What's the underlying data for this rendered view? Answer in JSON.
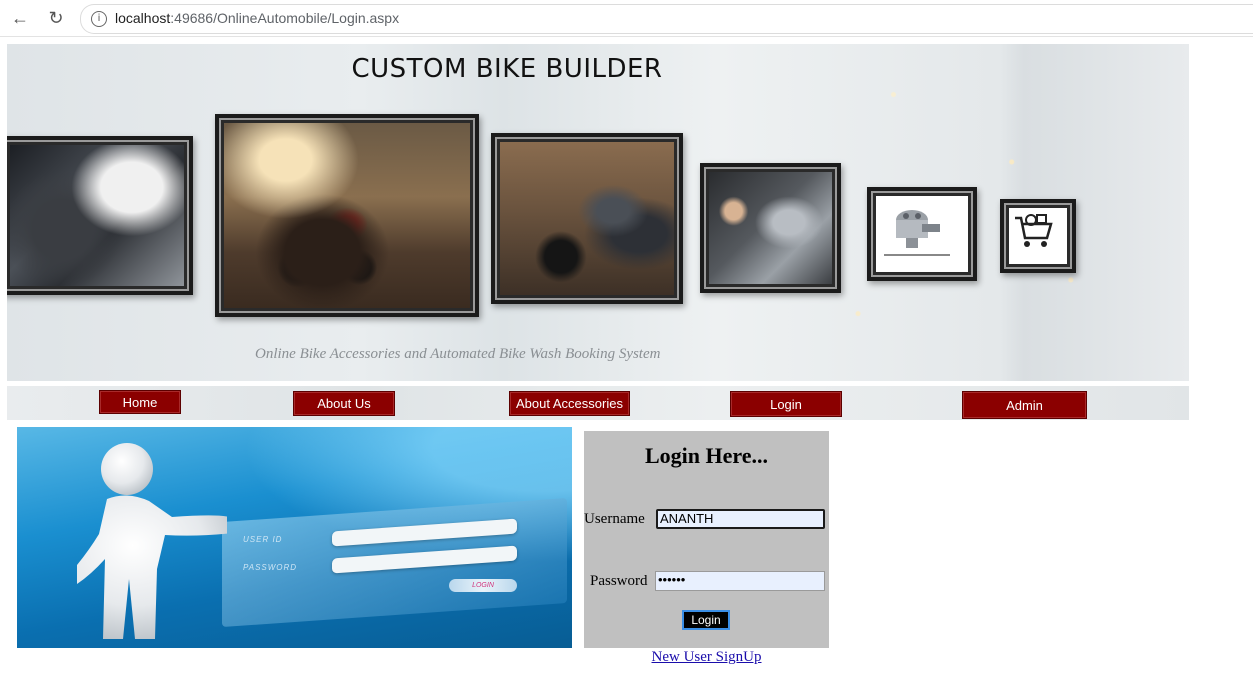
{
  "browser": {
    "url_host": "localhost",
    "url_rest": ":49686/OnlineAutomobile/Login.aspx"
  },
  "banner": {
    "title": "CUSTOM BIKE BUILDER",
    "subtitle": "Online Bike Accessories and Automated Bike Wash Booking System"
  },
  "nav": {
    "home": "Home",
    "about_us": "About Us",
    "about_accessories": "About Accessories",
    "login": "Login",
    "admin": "Admin"
  },
  "art": {
    "user_id_label": "USER ID",
    "password_label": "PASSWORD",
    "login_label": "LOGIN"
  },
  "login_form": {
    "title": "Login Here...",
    "username_label": "Username",
    "username_value": "ANANTH",
    "password_label": "Password",
    "password_value": "••••••",
    "login_button": "Login",
    "signup_link": "New User SignUp"
  },
  "colors": {
    "nav_button": "#8b0000",
    "form_background": "#c0c0c0",
    "link": "#1a0dab"
  }
}
